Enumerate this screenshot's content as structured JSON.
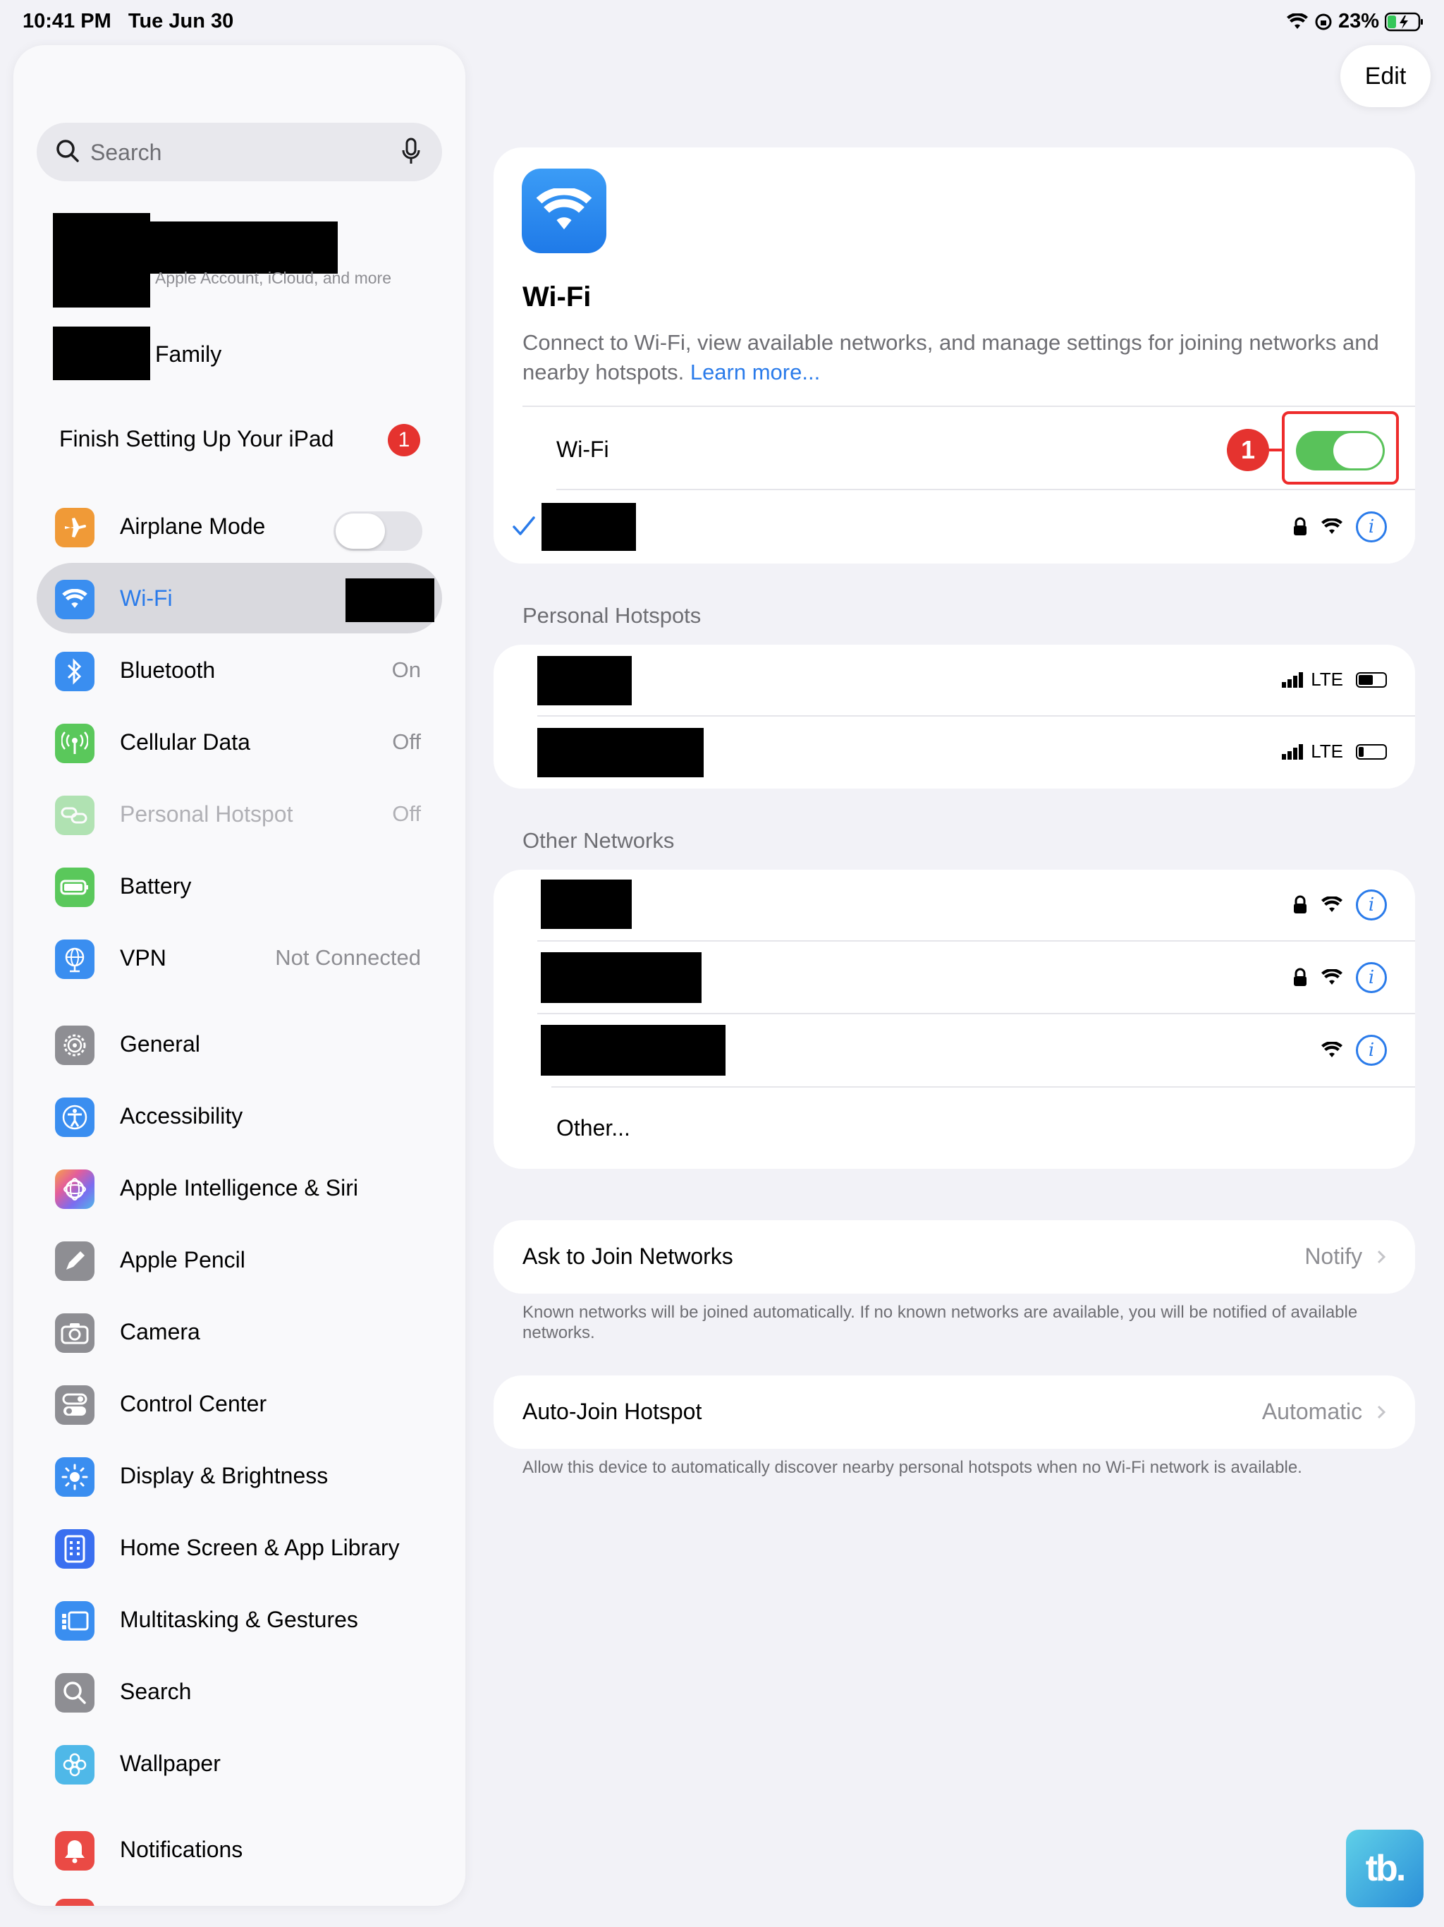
{
  "status_bar": {
    "time": "10:41 PM",
    "date": "Tue Jun 30",
    "battery": "23%"
  },
  "sidebar": {
    "search_placeholder": "Search",
    "account_subtitle": "Apple Account, iCloud, and more",
    "family_label": "Family",
    "finish_setup_label": "Finish Setting Up Your iPad",
    "finish_setup_badge": "1",
    "connectivity": [
      {
        "label": "Airplane Mode",
        "icon": "airplane-icon",
        "color": "#f09a37",
        "toggle": false
      },
      {
        "label": "Wi-Fi",
        "icon": "wifi-icon",
        "color": "#3a8ef0",
        "selected": true
      },
      {
        "label": "Bluetooth",
        "icon": "bluetooth-icon",
        "color": "#3a8ef0",
        "value": "On"
      },
      {
        "label": "Cellular Data",
        "icon": "antenna-icon",
        "color": "#5ac85b",
        "value": "Off"
      },
      {
        "label": "Personal Hotspot",
        "icon": "hotspot-icon",
        "color": "#5ac85b",
        "value": "Off",
        "dimmed": true
      },
      {
        "label": "Battery",
        "icon": "battery-icon",
        "color": "#5ac85b"
      },
      {
        "label": "VPN",
        "icon": "globe-icon",
        "color": "#3a8ef0",
        "value": "Not Connected"
      }
    ],
    "system": [
      {
        "label": "General",
        "icon": "gear-icon",
        "color": "#8e8e93"
      },
      {
        "label": "Accessibility",
        "icon": "accessibility-icon",
        "color": "#3a8ef0"
      },
      {
        "label": "Apple Intelligence & Siri",
        "icon": "siri-icon",
        "color": "#e35d9b"
      },
      {
        "label": "Apple Pencil",
        "icon": "pencil-icon",
        "color": "#8e8e93"
      },
      {
        "label": "Camera",
        "icon": "camera-icon",
        "color": "#8e8e93"
      },
      {
        "label": "Control Center",
        "icon": "switches-icon",
        "color": "#8e8e93"
      },
      {
        "label": "Display & Brightness",
        "icon": "sun-icon",
        "color": "#3a8ef0"
      },
      {
        "label": "Home Screen & App Library",
        "icon": "grid-icon",
        "color": "#3a6ff0"
      },
      {
        "label": "Multitasking & Gestures",
        "icon": "multitask-icon",
        "color": "#3a8ef0"
      },
      {
        "label": "Search",
        "icon": "search-icon",
        "color": "#8e8e93"
      },
      {
        "label": "Wallpaper",
        "icon": "flower-icon",
        "color": "#4fb8e8"
      }
    ],
    "notifications": {
      "label": "Notifications",
      "icon": "bell-icon",
      "color": "#ea4a45"
    }
  },
  "main": {
    "edit_label": "Edit",
    "wifi_title": "Wi-Fi",
    "wifi_desc": "Connect to Wi-Fi, view available networks, and manage settings for joining networks and nearby hotspots.",
    "learn_more": "Learn more...",
    "wifi_toggle_label": "Wi-Fi",
    "wifi_on": true,
    "annotation_number": "1",
    "personal_hotspots_header": "Personal Hotspots",
    "lte_label": "LTE",
    "hotspot_battery_levels": [
      0.55,
      0.2
    ],
    "other_networks_header": "Other Networks",
    "other_label": "Other...",
    "ask_join_label": "Ask to Join Networks",
    "ask_join_value": "Notify",
    "ask_join_note": "Known networks will be joined automatically. If no known networks are available, you will be notified of available networks.",
    "auto_join_label": "Auto-Join Hotspot",
    "auto_join_value": "Automatic",
    "auto_join_note": "Allow this device to automatically discover nearby personal hotspots when no Wi-Fi network is available."
  },
  "watermark": "tb."
}
